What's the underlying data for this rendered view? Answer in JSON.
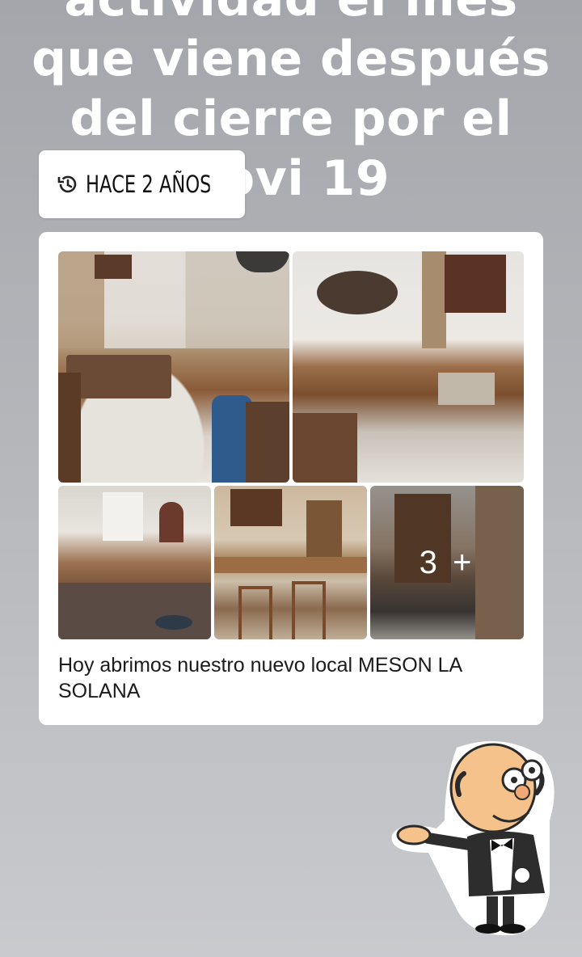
{
  "post": {
    "headline_lines": [
      "actividad el mes",
      "que viene después",
      "del cierre por el",
      "covi 19"
    ],
    "time_ago": "HACE 2 AÑOS",
    "photos_more_count": "3 +",
    "caption": "Hoy abrimos nuestro nuevo local MESON LA SOLANA"
  },
  "colors": {
    "background": "#b4b6ba",
    "card": "#ffffff",
    "text": "#1b1b1b"
  },
  "icons": {
    "time_chip": "history-icon",
    "mascot": "waiter-mascot-icon"
  }
}
